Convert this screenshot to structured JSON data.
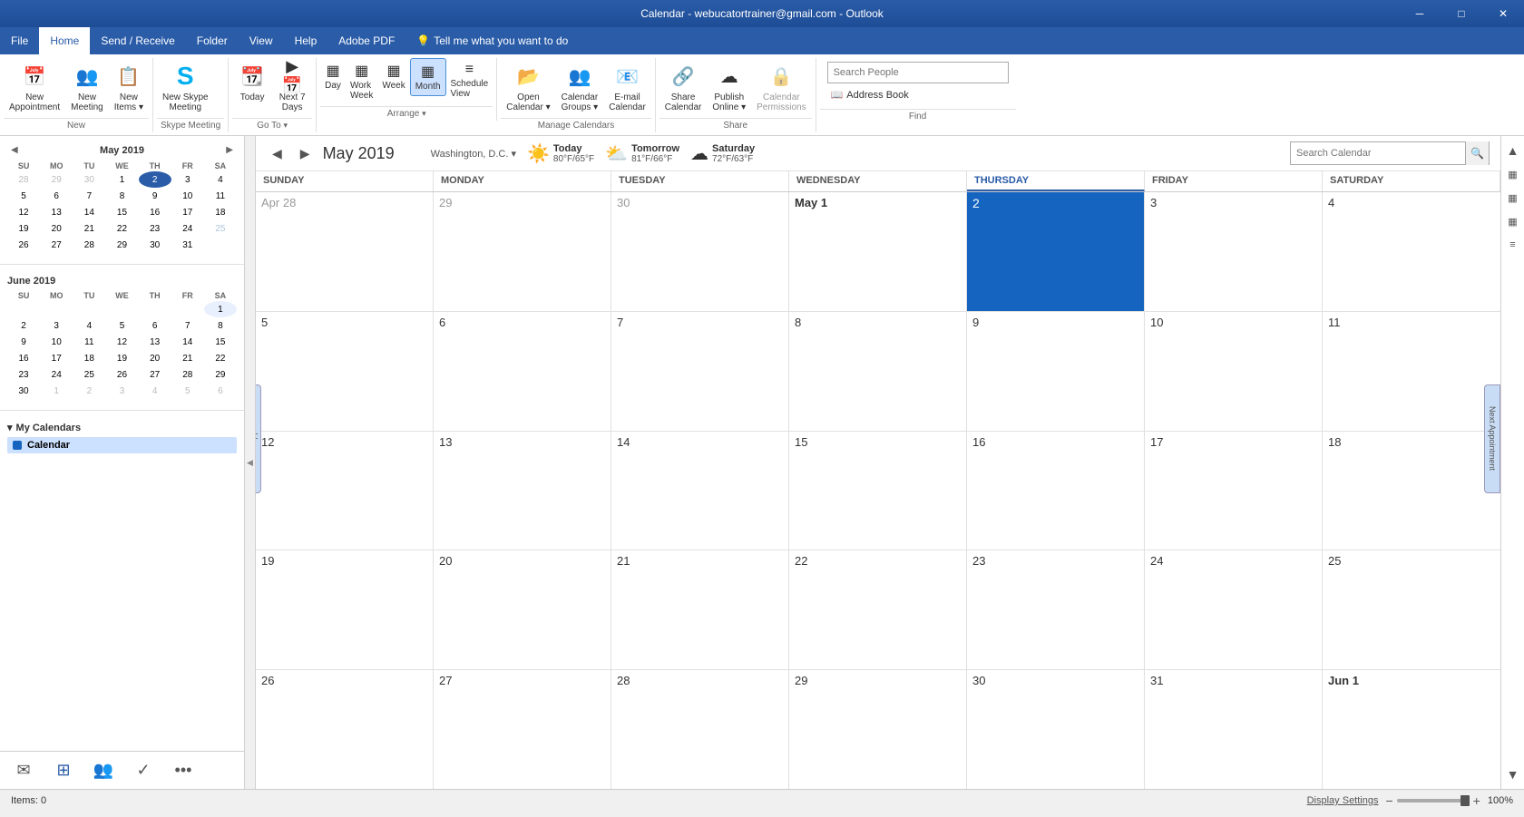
{
  "titlebar": {
    "title": "Calendar - webucatortrainer@gmail.com - Outlook",
    "min": "─",
    "max": "□",
    "close": "✕"
  },
  "menu": {
    "items": [
      "File",
      "Home",
      "Send / Receive",
      "Folder",
      "View",
      "Help",
      "Adobe PDF",
      "Tell me what you want to do"
    ]
  },
  "ribbon": {
    "groups": [
      {
        "label": "New",
        "buttons": [
          {
            "id": "new-appointment",
            "icon": "📅",
            "label": "New\nAppointment"
          },
          {
            "id": "new-meeting",
            "icon": "👥",
            "label": "New\nMeeting"
          },
          {
            "id": "new-items",
            "icon": "📋",
            "label": "New\nItems",
            "dropdown": true
          }
        ]
      },
      {
        "label": "Skype Meeting",
        "buttons": [
          {
            "id": "new-skype-meeting",
            "icon": "S",
            "label": "New Skype\nMeeting"
          }
        ]
      },
      {
        "label": "Go To",
        "buttons": [
          {
            "id": "today",
            "icon": "📆",
            "label": "Today"
          },
          {
            "id": "next-7-days",
            "icon": "▶",
            "label": "Next 7\nDays"
          }
        ]
      },
      {
        "label": "Arrange",
        "buttons": [
          {
            "id": "day-view",
            "icon": "▦",
            "label": "Day"
          },
          {
            "id": "work-week-view",
            "icon": "▦",
            "label": "Work\nWeek"
          },
          {
            "id": "week-view",
            "icon": "▦",
            "label": "Week"
          },
          {
            "id": "month-view",
            "icon": "▦",
            "label": "Month",
            "active": true
          },
          {
            "id": "schedule-view",
            "icon": "▦",
            "label": "Schedule\nView"
          }
        ]
      },
      {
        "label": "Manage Calendars",
        "buttons": [
          {
            "id": "open-calendar",
            "icon": "📂",
            "label": "Open\nCalendar",
            "dropdown": true
          },
          {
            "id": "calendar-groups",
            "icon": "👥",
            "label": "Calendar\nGroups",
            "dropdown": true
          },
          {
            "id": "email-calendar",
            "icon": "📧",
            "label": "E-mail\nCalendar"
          }
        ]
      },
      {
        "label": "Share",
        "buttons": [
          {
            "id": "share-calendar",
            "icon": "🔗",
            "label": "Share\nCalendar"
          },
          {
            "id": "publish-online",
            "icon": "☁",
            "label": "Publish\nOnline",
            "dropdown": true
          },
          {
            "id": "calendar-permissions",
            "icon": "🔒",
            "label": "Calendar\nPermissions",
            "disabled": true
          }
        ]
      },
      {
        "label": "Find",
        "search_placeholder": "Search People",
        "address_book_label": "Address Book"
      }
    ]
  },
  "sidebar": {
    "may2019": {
      "title": "May 2019",
      "weekdays": [
        "SU",
        "MO",
        "TU",
        "WE",
        "TH",
        "FR",
        "SA"
      ],
      "weeks": [
        [
          "28",
          "29",
          "30",
          "1",
          "2",
          "3",
          "4"
        ],
        [
          "5",
          "6",
          "7",
          "8",
          "9",
          "10",
          "11"
        ],
        [
          "12",
          "13",
          "14",
          "15",
          "16",
          "17",
          "18"
        ],
        [
          "19",
          "20",
          "21",
          "22",
          "23",
          "24",
          "25"
        ],
        [
          "26",
          "27",
          "28",
          "29",
          "30",
          "31",
          ""
        ]
      ],
      "other_month_days_first": [
        3,
        3
      ],
      "today_index": "4"
    },
    "june2019": {
      "title": "June 2019",
      "weekdays": [
        "SU",
        "MO",
        "TU",
        "WE",
        "TH",
        "FR",
        "SA"
      ],
      "weeks": [
        [
          "",
          "",
          "",
          "",
          "",
          "",
          "1"
        ],
        [
          "2",
          "3",
          "4",
          "5",
          "6",
          "7",
          "8"
        ],
        [
          "9",
          "10",
          "11",
          "12",
          "13",
          "14",
          "15"
        ],
        [
          "16",
          "17",
          "18",
          "19",
          "20",
          "21",
          "22"
        ],
        [
          "23",
          "24",
          "25",
          "26",
          "27",
          "28",
          "29"
        ],
        [
          "30",
          "1",
          "2",
          "3",
          "4",
          "5",
          "6"
        ]
      ]
    },
    "my_calendars_label": "My Calendars",
    "calendars": [
      {
        "name": "Calendar",
        "color": "#1565c0",
        "active": true
      }
    ],
    "bottom_buttons": [
      {
        "id": "mail",
        "icon": "✉",
        "tooltip": "Mail"
      },
      {
        "id": "calendar",
        "icon": "⊞",
        "tooltip": "Calendar",
        "active": true
      },
      {
        "id": "people",
        "icon": "👥",
        "tooltip": "People"
      },
      {
        "id": "tasks",
        "icon": "✓",
        "tooltip": "Tasks"
      },
      {
        "id": "more",
        "icon": "•••",
        "tooltip": "More"
      }
    ]
  },
  "calendar": {
    "month_title": "May 2019",
    "location": "Washington, D.C.",
    "weather": [
      {
        "label": "Today",
        "icon": "☀",
        "temp": "80°F/65°F"
      },
      {
        "label": "Tomorrow",
        "icon": "⛅",
        "temp": "81°F/66°F"
      },
      {
        "label": "Saturday",
        "icon": "☁",
        "temp": "72°F/63°F"
      }
    ],
    "search_placeholder": "Search Calendar",
    "day_headers": [
      "SUNDAY",
      "MONDAY",
      "TUESDAY",
      "WEDNESDAY",
      "THURSDAY",
      "FRIDAY",
      "SATURDAY"
    ],
    "today_col": 4,
    "weeks": [
      [
        {
          "date": "Apr 28",
          "style": "light"
        },
        {
          "date": "29",
          "style": "light"
        },
        {
          "date": "30",
          "style": "light"
        },
        {
          "date": "May 1",
          "style": "bold"
        },
        {
          "date": "2",
          "style": "today"
        },
        {
          "date": "3",
          "style": ""
        },
        {
          "date": "4",
          "style": ""
        }
      ],
      [
        {
          "date": "5",
          "style": ""
        },
        {
          "date": "6",
          "style": ""
        },
        {
          "date": "7",
          "style": ""
        },
        {
          "date": "8",
          "style": ""
        },
        {
          "date": "9",
          "style": ""
        },
        {
          "date": "10",
          "style": ""
        },
        {
          "date": "11",
          "style": ""
        }
      ],
      [
        {
          "date": "12",
          "style": ""
        },
        {
          "date": "13",
          "style": ""
        },
        {
          "date": "14",
          "style": ""
        },
        {
          "date": "15",
          "style": ""
        },
        {
          "date": "16",
          "style": ""
        },
        {
          "date": "17",
          "style": ""
        },
        {
          "date": "18",
          "style": ""
        }
      ],
      [
        {
          "date": "19",
          "style": ""
        },
        {
          "date": "20",
          "style": ""
        },
        {
          "date": "21",
          "style": ""
        },
        {
          "date": "22",
          "style": ""
        },
        {
          "date": "23",
          "style": ""
        },
        {
          "date": "24",
          "style": ""
        },
        {
          "date": "25",
          "style": ""
        }
      ],
      [
        {
          "date": "26",
          "style": ""
        },
        {
          "date": "27",
          "style": ""
        },
        {
          "date": "28",
          "style": ""
        },
        {
          "date": "29",
          "style": ""
        },
        {
          "date": "30",
          "style": ""
        },
        {
          "date": "31",
          "style": ""
        },
        {
          "date": "Jun 1",
          "style": "bold"
        }
      ]
    ],
    "prev_appt_label": "Previous Appointment",
    "next_appt_label": "Next Appointment"
  },
  "statusbar": {
    "items_label": "Items: 0",
    "display_settings": "Display Settings",
    "zoom": "100%"
  }
}
